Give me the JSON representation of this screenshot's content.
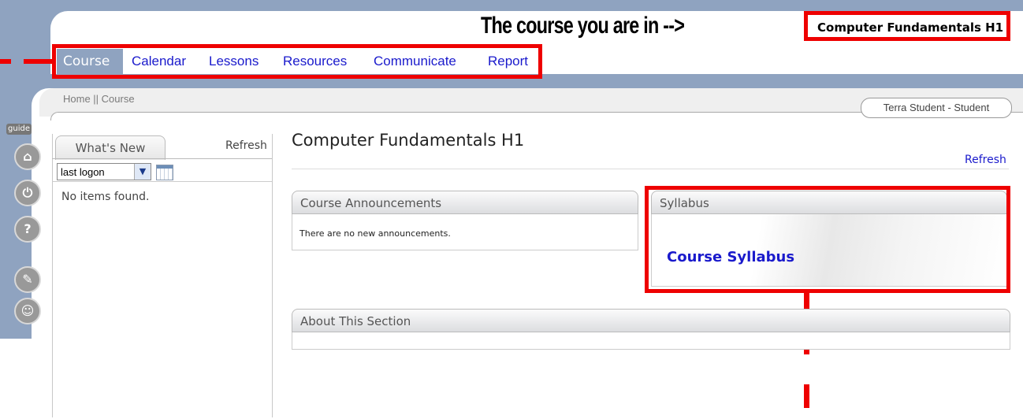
{
  "annotation": {
    "course_pointer": "The course you are in -->",
    "current_course": "Computer Fundamentals H1"
  },
  "nav": {
    "items": [
      "Course",
      "Calendar",
      "Lessons",
      "Resources",
      "Communicate",
      "Report"
    ],
    "active": "Course"
  },
  "breadcrumb": "Home || Course",
  "user_badge": "Terra Student - Student",
  "sidebar": {
    "guide_label": "guide",
    "icons": [
      "home-icon",
      "power-icon",
      "help-icon",
      "tools-icon",
      "chat-icon"
    ]
  },
  "whats_new": {
    "tab_label": "What's New",
    "refresh_label": "Refresh",
    "filter_value": "last logon",
    "empty_text": "No items found."
  },
  "main": {
    "title": "Computer Fundamentals H1",
    "refresh_label": "Refresh",
    "announcements": {
      "header": "Course Announcements",
      "body": "There are no new announcements."
    },
    "syllabus": {
      "header": "Syllabus",
      "link": "Course Syllabus"
    },
    "about": {
      "header": "About This Section"
    }
  },
  "colors": {
    "frame": "#8fa3c0",
    "annotation_red": "#ee0000",
    "link_blue": "#1a1acc"
  }
}
